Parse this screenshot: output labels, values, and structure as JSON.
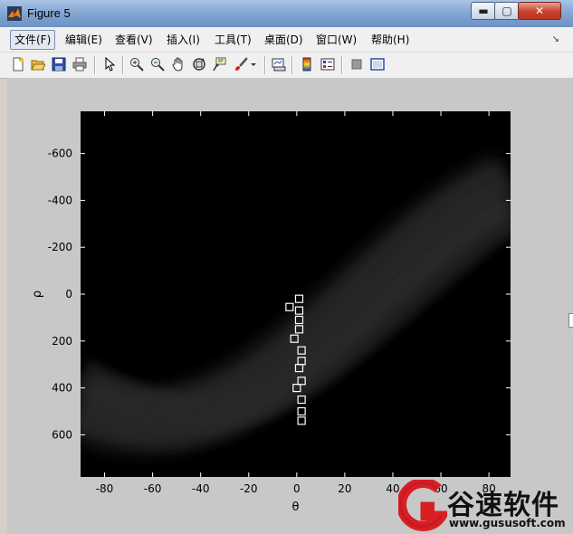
{
  "window": {
    "title": "Figure 5",
    "min_glyph": "▬",
    "max_glyph": "▢",
    "close_glyph": "✕"
  },
  "menubar": {
    "items": [
      "文件(F)",
      "编辑(E)",
      "查看(V)",
      "插入(I)",
      "工具(T)",
      "桌面(D)",
      "窗口(W)",
      "帮助(H)"
    ],
    "overflow_glyph": "↘"
  },
  "toolbar": {
    "icons": [
      "new-figure-icon",
      "open-file-icon",
      "save-icon",
      "print-icon",
      "select-arrow-icon",
      "zoom-in-icon",
      "zoom-out-icon",
      "pan-hand-icon",
      "rotate-3d-icon",
      "data-cursor-icon",
      "brush-icon",
      "brush-dropdown-icon",
      "link-plot-icon",
      "colorbar-icon",
      "legend-icon",
      "hide-plot-tools-icon",
      "show-plot-tools-icon"
    ]
  },
  "chart_data": {
    "type": "heatmap",
    "title": "",
    "xlabel": "θ",
    "ylabel": "ρ",
    "xlim": [
      -90,
      89
    ],
    "ylim": [
      -780,
      780
    ],
    "y_reversed": true,
    "xticks": [
      -80,
      -60,
      -40,
      -20,
      0,
      20,
      40,
      60,
      80
    ],
    "yticks": [
      -600,
      -400,
      -200,
      0,
      200,
      400,
      600
    ],
    "colormap": "gray",
    "background": "#000000",
    "markers": {
      "shape": "square",
      "color": "#ffffff",
      "points": [
        {
          "theta": 1,
          "rho": 20
        },
        {
          "theta": -3,
          "rho": 55
        },
        {
          "theta": 1,
          "rho": 70
        },
        {
          "theta": 1,
          "rho": 110
        },
        {
          "theta": 1,
          "rho": 150
        },
        {
          "theta": -1,
          "rho": 190
        },
        {
          "theta": 2,
          "rho": 240
        },
        {
          "theta": 2,
          "rho": 285
        },
        {
          "theta": 1,
          "rho": 315
        },
        {
          "theta": 2,
          "rho": 370
        },
        {
          "theta": 0,
          "rho": 400
        },
        {
          "theta": 2,
          "rho": 450
        },
        {
          "theta": 2,
          "rho": 500
        },
        {
          "theta": 2,
          "rho": 540
        }
      ]
    }
  },
  "watermark": {
    "brand": "谷速软件",
    "url": "www.gususoft.com"
  }
}
